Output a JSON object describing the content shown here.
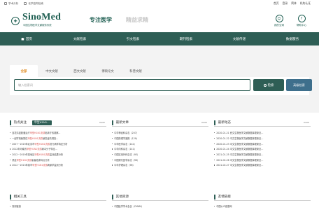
{
  "topbar": {
    "links": [
      {
        "label": "学术分析",
        "icon": "chart-icon"
      },
      {
        "label": "化学结构检索",
        "icon": "molecule-icon"
      }
    ],
    "right": [
      "首页",
      "登录",
      "简体",
      "机构认证"
    ]
  },
  "header": {
    "logo_text": "SinoMed",
    "logo_sub": "中国生物医学文献服务系统",
    "slogan_primary": "专注医学",
    "slogan_secondary": "精益求精",
    "buttons": [
      {
        "label": "我的空间",
        "icon": "user-icon"
      },
      {
        "label": "帮助中心",
        "icon": "help-icon"
      }
    ]
  },
  "nav": {
    "items": [
      "首页",
      "文献检索",
      "引文检索",
      "期刊检索",
      "文献传递",
      "数据服务"
    ]
  },
  "search": {
    "tabs": [
      "全部",
      "中文文献",
      "西文文献",
      "博硕论文",
      "科普文献"
    ],
    "active_tab": "全部",
    "placeholder": "输入检索词",
    "search_button": "检索",
    "advanced_button": "高级检索"
  },
  "panels": {
    "hot": {
      "title": "热点关注",
      "badge": "甲型H1N1...",
      "more": "more",
      "items": [
        {
          "pre": "连花清瘟胶囊治疗",
          "hl": "甲型H1N1流感",
          "post": "临床疗效观察..."
        },
        {
          "pre": "一起学校聚集性",
          "hl": "甲型H1N1流感",
          "post": "暴发疫情调查..."
        },
        {
          "pre": "2007－2019年北京市",
          "hl": "甲型H1N1流感",
          "post": "流行病学特征分析"
        },
        {
          "pre": "2012年河南省",
          "hl": "甲型H1N1流感",
          "post": "病毒分子特征..."
        },
        {
          "pre": "2012－2019年某地区",
          "hl": "甲型H1N1流感",
          "post": "监测结果分析"
        },
        {
          "pre": "重症",
          "hl": "甲型H1N1流感",
          "post": "患者临床特点分析"
        },
        {
          "pre": "2012－2013年某市",
          "hl": "甲型H1N1流感",
          "post": "病原学监测分析"
        }
      ]
    },
    "new": {
      "title": "最新文章",
      "more": "more",
      "items": [
        "中华神经科杂志（207）",
        "中国药理学通报（129）",
        "中华医学杂志（142）",
        "中华内科杂志（141）",
        "中国实用外科杂志（93）",
        "中国现代医学杂志（96）",
        "中华护理杂志（96）"
      ]
    },
    "news": {
      "title": "最新动态",
      "more": "more",
      "items": [
        "2020-01-21 西文生物医学文献数据库更新至...",
        "2020-01-22 中文生物医学文献数据库更新至...",
        "2020-01-23 中文生物医学文献数据库更新至...",
        "2020-01-24 中文生物医学文献数据库更新至...",
        "2021-01-25 中文生物医学文献数据库更新至...",
        "2021-02-26 中文生物医学文献数据库更新至...",
        "2021-02-27 中文生物医学文献数据库更新至..."
      ]
    }
  },
  "bottom_panels": {
    "tools": {
      "title": "相关工具",
      "item": "常用链接"
    },
    "services": {
      "title": "其他资源",
      "item": "中国医学学术会议（CMAM）"
    },
    "links": {
      "title": "友情链接",
      "item": "中国公众健康网"
    }
  },
  "colors": {
    "brand": "#2e5e55",
    "accent": "#e08a1e",
    "highlight": "#d9534f",
    "advanced": "#3e6f8c"
  }
}
